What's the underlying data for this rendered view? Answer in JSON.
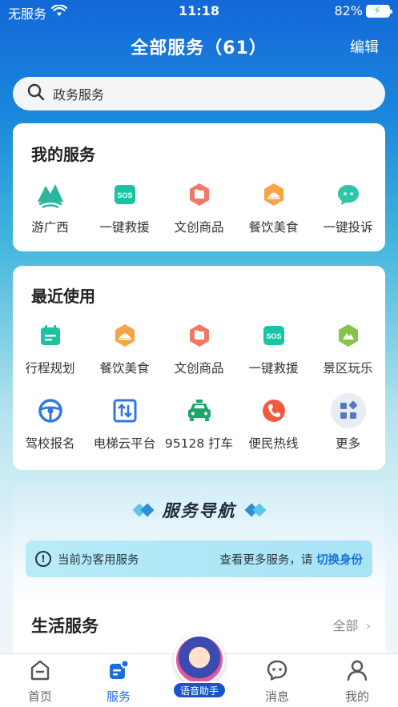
{
  "status_bar": {
    "carrier": "无服务",
    "time": "11:18",
    "battery": "82%"
  },
  "header": {
    "title": "全部服务（61）",
    "edit": "编辑"
  },
  "search": {
    "placeholder": "政务服务"
  },
  "my_services": {
    "title": "我的服务",
    "items": [
      {
        "label": "游广西",
        "icon": "guangxi-mountain-icon"
      },
      {
        "label": "一键救援",
        "icon": "sos-icon"
      },
      {
        "label": "文创商品",
        "icon": "folder-icon"
      },
      {
        "label": "餐饮美食",
        "icon": "food-dome-icon"
      },
      {
        "label": "一键投诉",
        "icon": "chat-bubble-icon"
      }
    ]
  },
  "recent": {
    "title": "最近使用",
    "items": [
      {
        "label": "行程规划",
        "icon": "calendar-icon"
      },
      {
        "label": "餐饮美食",
        "icon": "food-dome-icon"
      },
      {
        "label": "文创商品",
        "icon": "folder-icon"
      },
      {
        "label": "一键救援",
        "icon": "sos-icon"
      },
      {
        "label": "景区玩乐",
        "icon": "scenic-icon"
      },
      {
        "label": "驾校报名",
        "icon": "steering-wheel-icon"
      },
      {
        "label": "电梯云平台",
        "icon": "elevator-icon"
      },
      {
        "label": "95128 打车",
        "icon": "taxi-icon"
      },
      {
        "label": "便民热线",
        "icon": "phone-icon"
      },
      {
        "label": "更多",
        "icon": "more-grid-icon"
      }
    ]
  },
  "service_nav": {
    "title": "服务导航",
    "notice_left": "当前为客用服务",
    "notice_right": "查看更多服务，请",
    "notice_link": "切换身份",
    "life_title": "生活服务",
    "life_all": "全部"
  },
  "assistant": {
    "label": "语音助手"
  },
  "tabs": [
    {
      "label": "首页"
    },
    {
      "label": "服务"
    },
    {
      "label": "消息"
    },
    {
      "label": "我的"
    }
  ],
  "colors": {
    "accent": "#1a6fe0",
    "link": "#1673d6"
  }
}
